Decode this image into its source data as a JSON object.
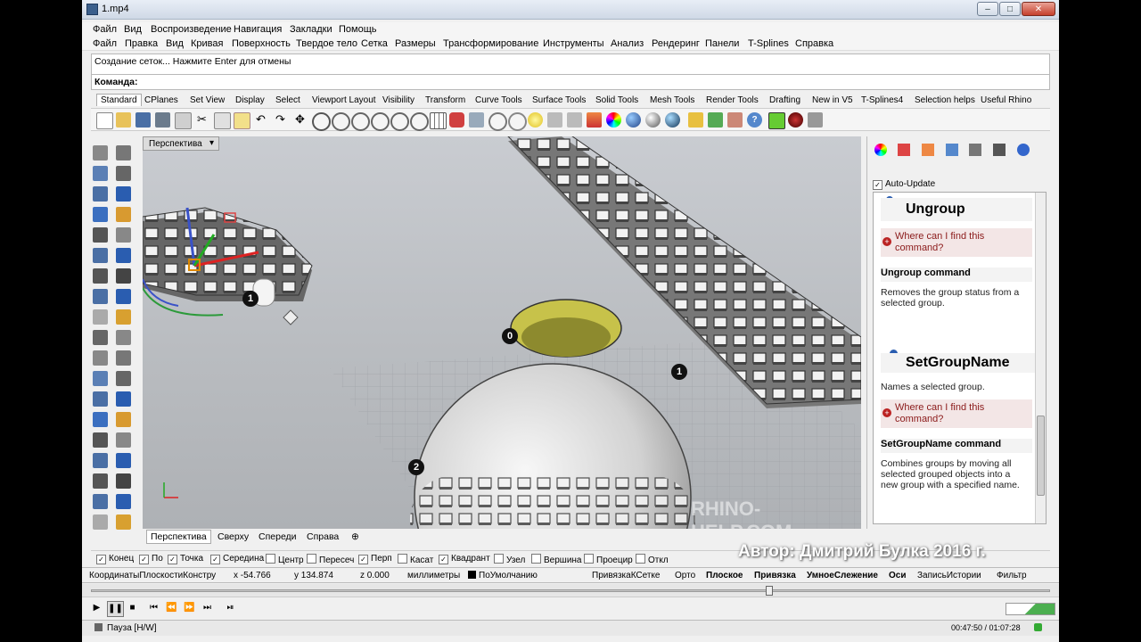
{
  "player": {
    "title": "1.mp4",
    "menu": [
      "Файл",
      "Вид",
      "Воспроизведение",
      "Навигация",
      "Закладки",
      "Помощь"
    ],
    "time": "00:47:50 / 01:07:28",
    "status": "Пауза [H/W]"
  },
  "rhino": {
    "menu": [
      "Файл",
      "Правка",
      "Вид",
      "Кривая",
      "Поверхность",
      "Твердое тело",
      "Сетка",
      "Размеры",
      "Трансформирование",
      "Инструменты",
      "Анализ",
      "Рендеринг",
      "Панели",
      "T-Splines",
      "Справка"
    ],
    "command_history": "Создание сеток... Нажмите Enter для отмены",
    "command_prompt": "Команда:",
    "toolbar_tabs": [
      "Standard",
      "CPlanes",
      "Set View",
      "Display",
      "Select",
      "Viewport Layout",
      "Visibility",
      "Transform",
      "Curve Tools",
      "Surface Tools",
      "Solid Tools",
      "Mesh Tools",
      "Render Tools",
      "Drafting",
      "New in V5",
      "T-Splines4",
      "Selection helps",
      "Useful Rhino"
    ],
    "viewport_title": "Перспектива",
    "viewport_tabs": [
      "Перспектива",
      "Сверху",
      "Спереди",
      "Справа"
    ],
    "watermark": "RHINO-HELP.COM",
    "point_labels": [
      "1",
      "0",
      "1",
      "2"
    ],
    "help_panel": {
      "auto_update_label": "Auto-Update",
      "cmd1_title": "Ungroup",
      "cmd1_where": "Where can I find this command?",
      "cmd1_heading": "Ungroup command",
      "cmd1_desc": "Removes the group status from a selected group.",
      "cmd2_title": "SetGroupName",
      "cmd2_summary": "Names a selected group.",
      "cmd2_where": "Where can I find this command?",
      "cmd2_heading": "SetGroupName command",
      "cmd2_desc": "Combines groups by moving all selected grouped objects into a new group with a specified name."
    },
    "osnaps": [
      {
        "label": "Конец",
        "checked": true
      },
      {
        "label": "По",
        "checked": true
      },
      {
        "label": "Точка",
        "checked": true
      },
      {
        "label": "Середина",
        "checked": true
      },
      {
        "label": "Центр",
        "checked": false
      },
      {
        "label": "Пересеч",
        "checked": false
      },
      {
        "label": "Перп",
        "checked": true
      },
      {
        "label": "Касат",
        "checked": false
      },
      {
        "label": "Квадрант",
        "checked": true
      },
      {
        "label": "Узел",
        "checked": false
      },
      {
        "label": "Вершина",
        "checked": false
      },
      {
        "label": "Проецир",
        "checked": false
      },
      {
        "label": "Откл",
        "checked": false
      }
    ],
    "status": {
      "cplane": "КоординатыПлоскостиКонстру",
      "x": "x -54.766",
      "y": "y 134.874",
      "z": "z 0.000",
      "units": "миллиметры",
      "layer": "ПоУмолчанию",
      "toggles": [
        "ПривязкаКСетке",
        "Орто",
        "Плоское",
        "Привязка",
        "УмноеСлежение",
        "Оси",
        "ЗаписьИстории",
        "Фильтр"
      ]
    }
  },
  "overlay_author": "Автор: Дмитрий Булка 2016 г."
}
